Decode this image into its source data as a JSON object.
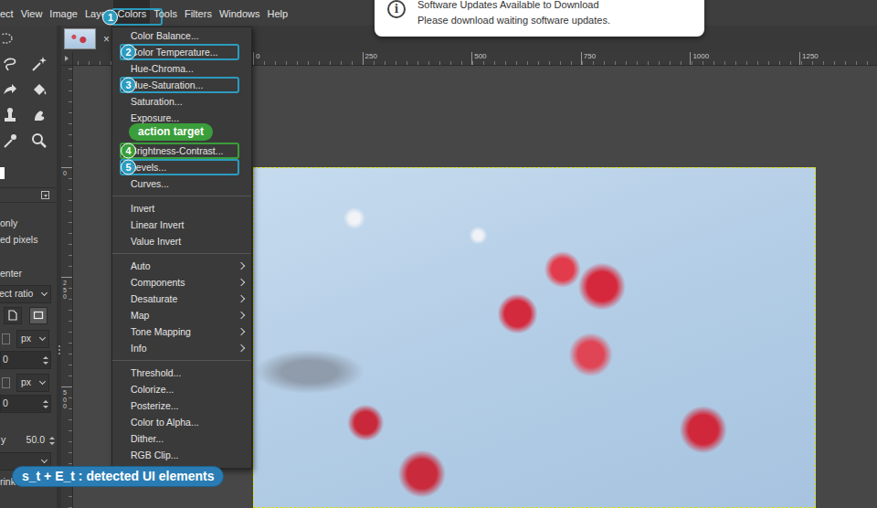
{
  "menubar": [
    {
      "label": "ect",
      "selected": false
    },
    {
      "label": "View",
      "selected": false
    },
    {
      "label": "Image",
      "selected": false
    },
    {
      "label": "Layer",
      "selected": false
    },
    {
      "label": "Colors",
      "selected": true,
      "annotation": {
        "number": "1",
        "color": "#2b9bbf"
      }
    },
    {
      "label": "Tools",
      "selected": false
    },
    {
      "label": "Filters",
      "selected": false
    },
    {
      "label": "Windows",
      "selected": false
    },
    {
      "label": "Help",
      "selected": false
    }
  ],
  "notification": {
    "icon": "i",
    "title": "Software Updates Available to Download",
    "body": "Please download waiting software updates."
  },
  "image_tab": {
    "close": "×"
  },
  "rulers": {
    "horizontal": [
      "0",
      "250",
      "500",
      "750",
      "1000",
      "1250"
    ],
    "vertical": [
      "0",
      "250",
      "500"
    ]
  },
  "tool_options": [
    {
      "kind": "text",
      "label": "only"
    },
    {
      "kind": "text",
      "label": "ed pixels"
    },
    {
      "kind": "text",
      "label": "enter"
    },
    {
      "kind": "dropdown",
      "label": "ect ratio"
    },
    {
      "kind": "buttons"
    },
    {
      "kind": "unit",
      "label": "px"
    },
    {
      "kind": "spin",
      "value": "0"
    },
    {
      "kind": "unit",
      "label": "px"
    },
    {
      "kind": "spin",
      "value": "0"
    },
    {
      "kind": "spin",
      "label": "y",
      "value": "50.0"
    },
    {
      "kind": "dropdown"
    },
    {
      "kind": "text",
      "label": "rink"
    }
  ],
  "colors_menu": [
    [
      {
        "kind": "entry",
        "label": "Color Balance..."
      },
      {
        "kind": "entry",
        "label": "Color Temperature...",
        "annotation": {
          "number": "2",
          "color": "#2b9bbf"
        }
      },
      {
        "kind": "entry",
        "label": "Hue-Chroma..."
      },
      {
        "kind": "entry",
        "label": "Hue-Saturation...",
        "annotation": {
          "number": "3",
          "color": "#2b9bbf"
        }
      },
      {
        "kind": "entry",
        "label": "Saturation..."
      },
      {
        "kind": "entry",
        "label": "Exposure..."
      },
      {
        "kind": "covered"
      },
      {
        "kind": "entry",
        "label": "Brightness-Contrast...",
        "annotation": {
          "number": "4",
          "color": "#3a9e3a",
          "label": "action target"
        }
      },
      {
        "kind": "entry",
        "label": "Levels...",
        "annotation": {
          "number": "5",
          "color": "#2b9bbf"
        }
      },
      {
        "kind": "entry",
        "label": "Curves..."
      }
    ],
    [
      {
        "kind": "entry",
        "label": "Invert"
      },
      {
        "kind": "entry",
        "label": "Linear Invert"
      },
      {
        "kind": "entry",
        "label": "Value Invert"
      }
    ],
    [
      {
        "kind": "submenu",
        "label": "Auto"
      },
      {
        "kind": "submenu",
        "label": "Components"
      },
      {
        "kind": "submenu",
        "label": "Desaturate"
      },
      {
        "kind": "submenu",
        "label": "Map"
      },
      {
        "kind": "submenu",
        "label": "Tone Mapping"
      },
      {
        "kind": "submenu",
        "label": "Info"
      }
    ],
    [
      {
        "kind": "entry",
        "label": "Threshold..."
      },
      {
        "kind": "entry",
        "label": "Colorize..."
      },
      {
        "kind": "entry",
        "label": "Posterize..."
      },
      {
        "kind": "entry",
        "label": "Color to Alpha..."
      },
      {
        "kind": "entry",
        "label": "Dither..."
      },
      {
        "kind": "entry",
        "label": "RGB Clip..."
      }
    ]
  ],
  "caption": "s_t + E_t : detected UI elements"
}
